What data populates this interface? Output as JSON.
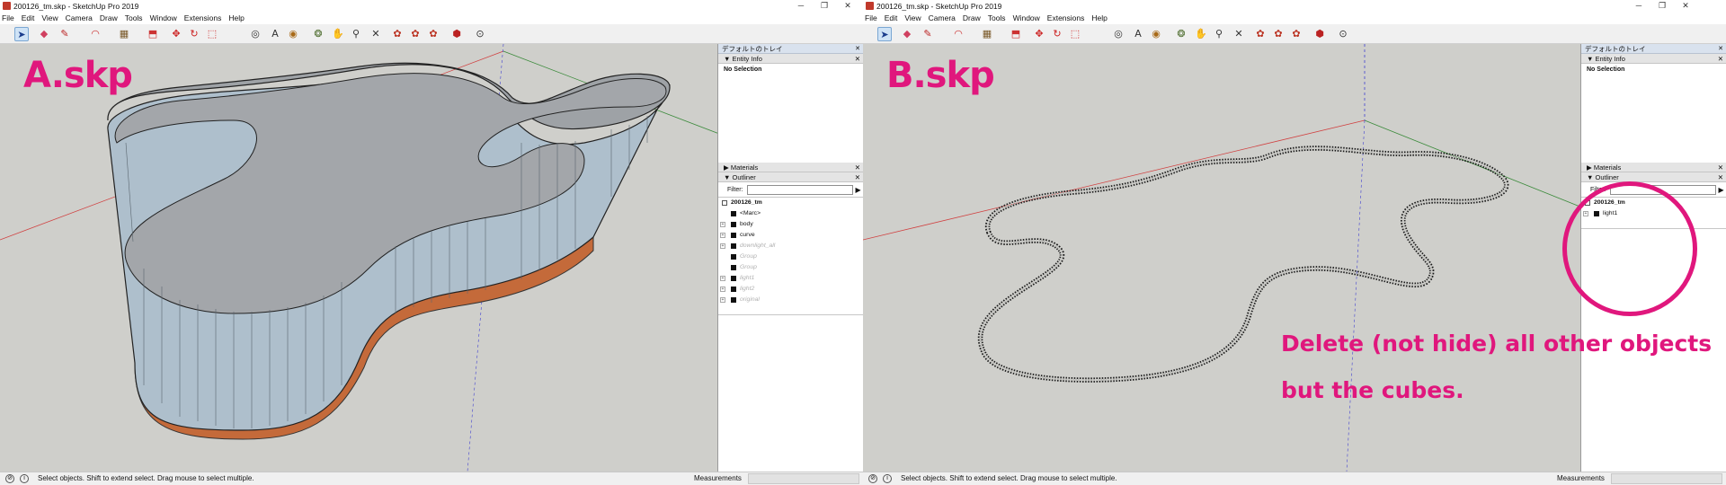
{
  "left": {
    "window_title": "200126_tm.skp - SketchUp Pro 2019",
    "menu": [
      "File",
      "Edit",
      "View",
      "Camera",
      "Draw",
      "Tools",
      "Window",
      "Extensions",
      "Help"
    ],
    "label": "A.skp",
    "tray_title": "デフォルトのトレイ",
    "entity_info": "Entity Info",
    "no_selection": "No Selection",
    "materials": "Materials",
    "outliner": "Outliner",
    "filter_label": "Filter:",
    "outliner_items": [
      {
        "name": "200126_tm",
        "kind": "model",
        "dim": false
      },
      {
        "name": "<Marc>",
        "kind": "group",
        "dim": false
      },
      {
        "name": "body",
        "kind": "component",
        "dim": false
      },
      {
        "name": "curve",
        "kind": "component",
        "dim": false
      },
      {
        "name": "downlight_all",
        "kind": "component",
        "dim": true
      },
      {
        "name": "Group",
        "kind": "group",
        "dim": true
      },
      {
        "name": "Group",
        "kind": "group",
        "dim": true
      },
      {
        "name": "light1",
        "kind": "component",
        "dim": true
      },
      {
        "name": "light2",
        "kind": "component",
        "dim": true
      },
      {
        "name": "original",
        "kind": "component",
        "dim": true
      }
    ],
    "status_text": "Select objects. Shift to extend select. Drag mouse to select multiple.",
    "measurements": "Measurements"
  },
  "right": {
    "window_title": "200126_tm.skp - SketchUp Pro 2019",
    "menu": [
      "File",
      "Edit",
      "View",
      "Camera",
      "Draw",
      "Tools",
      "Window",
      "Extensions",
      "Help"
    ],
    "label": "B.skp",
    "tray_title": "デフォルトのトレイ",
    "entity_info": "Entity Info",
    "no_selection": "No Selection",
    "materials": "Materials",
    "outliner": "Outliner",
    "filter_label": "Filter:",
    "outliner_items": [
      {
        "name": "200126_tm",
        "kind": "model",
        "dim": false
      },
      {
        "name": "light1",
        "kind": "component",
        "dim": false
      }
    ],
    "status_text": "Select objects. Shift to extend select. Drag mouse to select multiple.",
    "measurements": "Measurements"
  },
  "annotation": {
    "line1": "Delete (not hide) all other objects",
    "line2": "but the cubes."
  },
  "colors": {
    "accent": "#e0177d",
    "viewport_bg": "#cfcfcb",
    "wall": "#aebfcc",
    "roof": "#9ea2a6",
    "base": "#c46a3a"
  },
  "icons": {
    "app": "sketchup-icon",
    "minimize": "minimize-icon",
    "maximize": "maximize-icon",
    "close": "close-icon"
  }
}
